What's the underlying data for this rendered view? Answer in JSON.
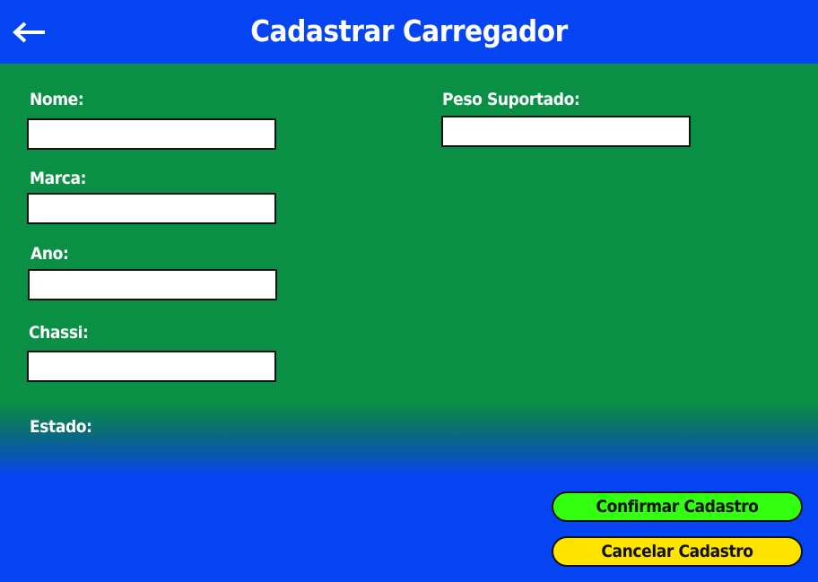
{
  "header": {
    "title": "Cadastrar Carregador",
    "back_icon": "arrow-left-icon",
    "background": "#0444f2"
  },
  "form": {
    "nome": {
      "label": "Nome:",
      "value": "",
      "placeholder": ""
    },
    "marca": {
      "label": "Marca:",
      "value": "",
      "placeholder": ""
    },
    "ano": {
      "label": "Ano:",
      "value": "",
      "placeholder": ""
    },
    "chassi": {
      "label": "Chassi:",
      "value": "",
      "placeholder": ""
    },
    "peso_suportado": {
      "label": "Peso Suportado:",
      "value": "",
      "placeholder": ""
    },
    "estado": {
      "label": "Estado:"
    }
  },
  "actions": {
    "confirm_label": "Confirmar Cadastro",
    "cancel_label": "Cancelar Cadastro"
  },
  "colors": {
    "form_background": "#0a9045",
    "page_background": "#0444f2",
    "confirm_button": "#33ff11",
    "cancel_button": "#ffe400"
  }
}
